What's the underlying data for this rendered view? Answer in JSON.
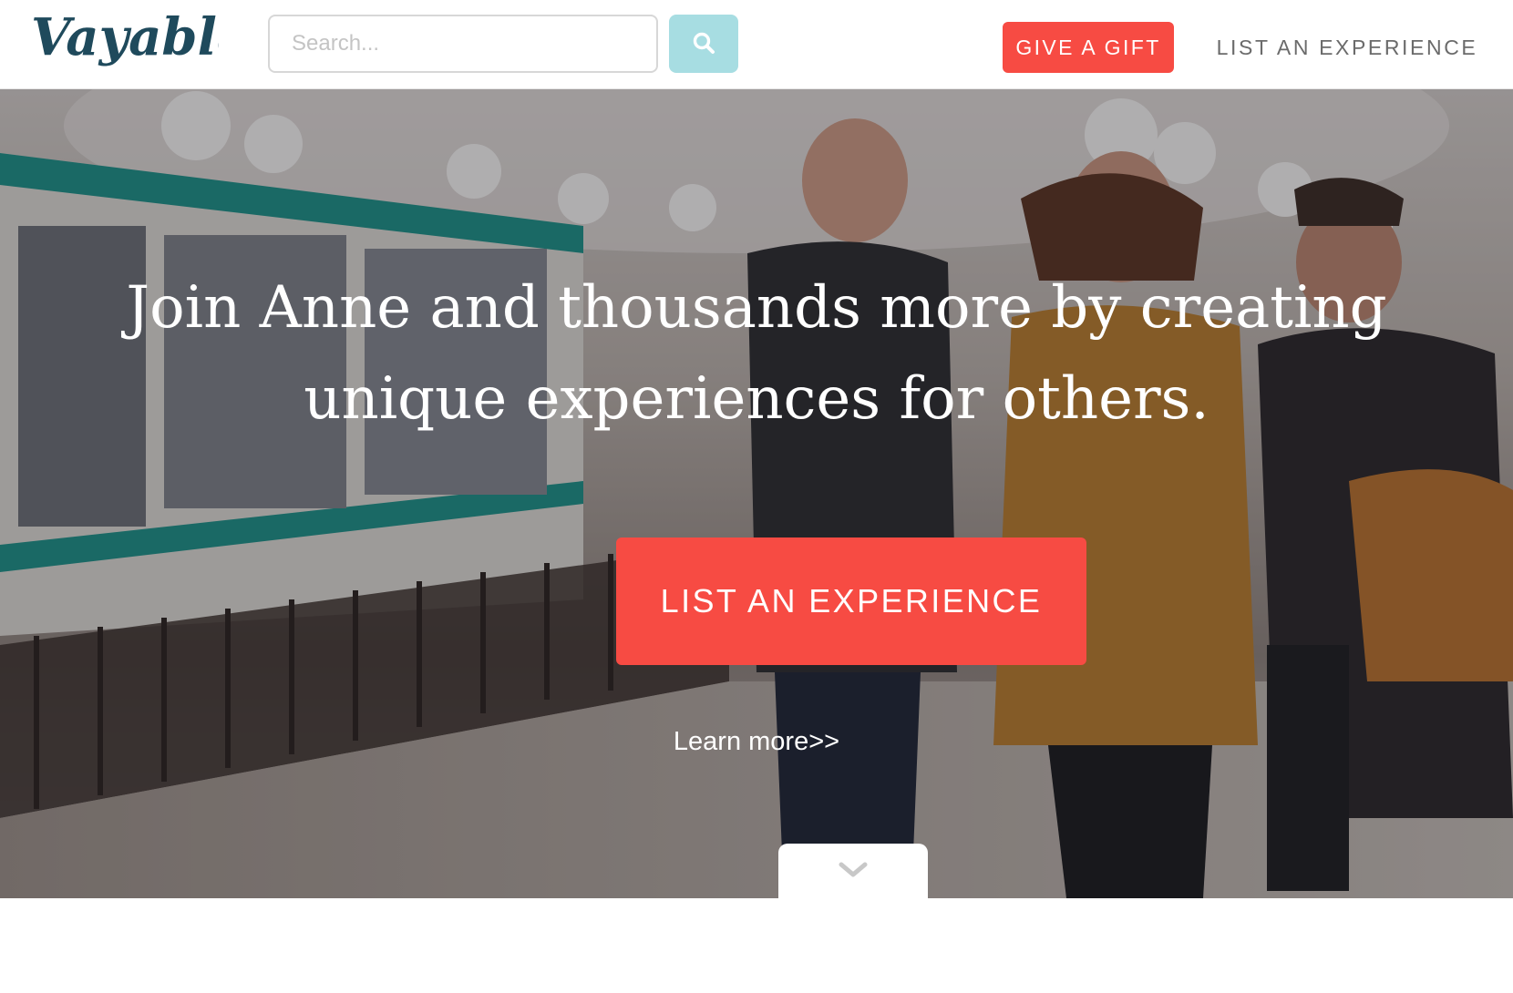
{
  "header": {
    "logo_text": "Vayable",
    "search": {
      "placeholder": "Search...",
      "value": "",
      "button_icon": "search-icon"
    },
    "gift_button_label": "GIVE A GIFT",
    "list_link_label": "LIST AN EXPERIENCE"
  },
  "hero": {
    "headline_line1": "Join Anne and thousands more by creating",
    "headline_line2": "unique experiences for others.",
    "cta_label": "LIST AN EXPERIENCE",
    "learn_more_label": "Learn more>>",
    "scroll_icon": "chevron-down-icon"
  },
  "colors": {
    "brand": "#1f4a5c",
    "accent": "#f74b43",
    "search_button": "#a7dde2",
    "nav_text": "#6b6b6b"
  }
}
